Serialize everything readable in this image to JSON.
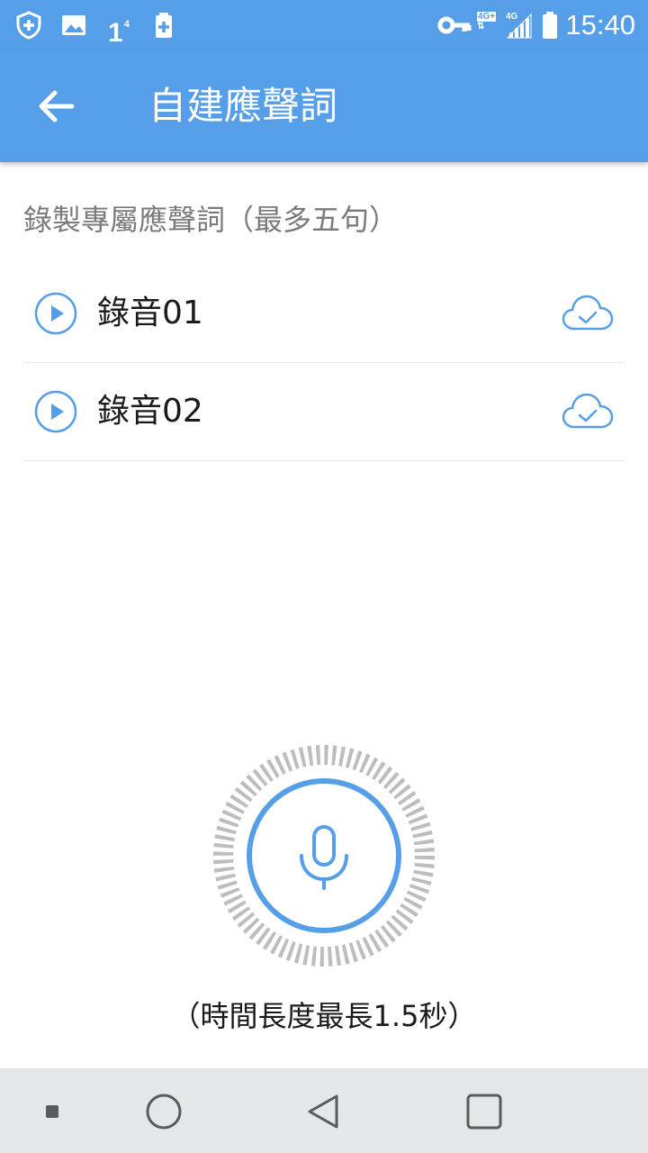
{
  "status_bar": {
    "time": "15:40",
    "sim_slot": "1",
    "sim_superscript": "4",
    "net_primary": "4G+",
    "net_secondary": "4G",
    "icons": [
      "shield-plus-icon",
      "image-icon",
      "battery-plus-icon",
      "vpn-key-icon",
      "signal-icon",
      "battery-icon"
    ]
  },
  "app_bar": {
    "title": "自建應聲詞",
    "back_icon": "arrow-left-icon"
  },
  "main": {
    "section_title": "錄製專屬應聲詞（最多五句）",
    "recordings": [
      {
        "name": "錄音01",
        "play_icon": "play-circle-icon",
        "status_icon": "cloud-check-icon"
      },
      {
        "name": "錄音02",
        "play_icon": "play-circle-icon",
        "status_icon": "cloud-check-icon"
      }
    ],
    "record_button_icon": "microphone-icon",
    "duration_note": "（時間長度最長1.5秒）"
  },
  "nav_bar": {
    "items": [
      "recents-dot-icon",
      "home-circle-icon",
      "back-triangle-icon",
      "overview-square-icon"
    ]
  },
  "colors": {
    "accent": "#569fe8",
    "status_bar_bg": "#569fe8",
    "ring_gray": "#bdbdbd",
    "nav_bg": "#e4e6ea",
    "text_primary": "#1a1a1a",
    "text_secondary": "#7a7a7a"
  }
}
